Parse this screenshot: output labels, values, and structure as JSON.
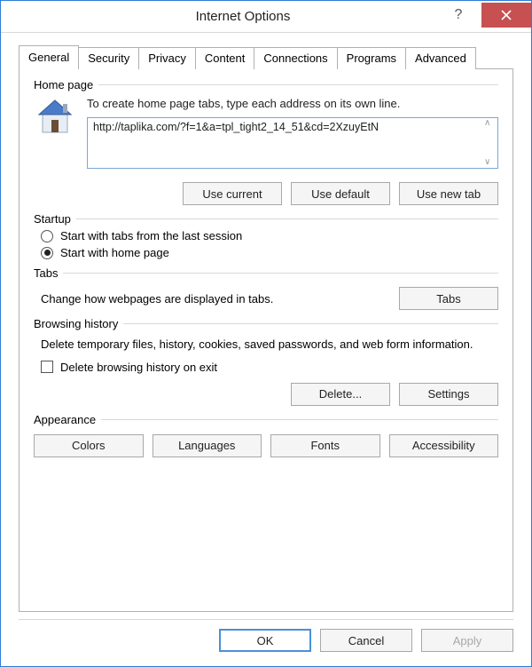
{
  "title": "Internet Options",
  "tabs": [
    "General",
    "Security",
    "Privacy",
    "Content",
    "Connections",
    "Programs",
    "Advanced"
  ],
  "activeTab": 0,
  "homePage": {
    "label": "Home page",
    "desc": "To create home page tabs, type each address on its own line.",
    "value": "http://taplika.com/?f=1&a=tpl_tight2_14_51&cd=2XzuyEtN",
    "useCurrent": "Use current",
    "useDefault": "Use default",
    "useNewTab": "Use new tab"
  },
  "startup": {
    "label": "Startup",
    "opt1": "Start with tabs from the last session",
    "opt2": "Start with home page",
    "selected": 1
  },
  "tabsSection": {
    "label": "Tabs",
    "desc": "Change how webpages are displayed in tabs.",
    "btn": "Tabs"
  },
  "history": {
    "label": "Browsing history",
    "desc": "Delete temporary files, history, cookies, saved passwords, and web form information.",
    "checkbox": "Delete browsing history on exit",
    "checked": false,
    "deleteBtn": "Delete...",
    "settingsBtn": "Settings"
  },
  "appearance": {
    "label": "Appearance",
    "colors": "Colors",
    "languages": "Languages",
    "fonts": "Fonts",
    "accessibility": "Accessibility"
  },
  "footer": {
    "ok": "OK",
    "cancel": "Cancel",
    "apply": "Apply"
  }
}
